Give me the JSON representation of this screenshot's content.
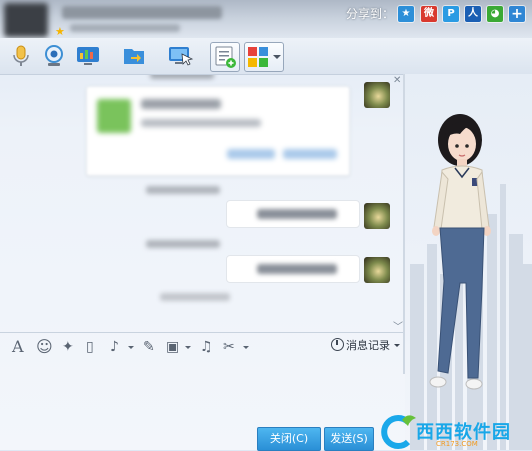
{
  "title_bar": {
    "share_label": "分享到：",
    "share_targets": [
      {
        "name": "qzone-share-icon",
        "glyph": "★"
      },
      {
        "name": "weibo-share-icon",
        "glyph": "微"
      },
      {
        "name": "pengyou-share-icon",
        "glyph": "P"
      },
      {
        "name": "renren-share-icon",
        "glyph": "人"
      },
      {
        "name": "wechat-share-icon",
        "glyph": "◕"
      },
      {
        "name": "more-share-icon",
        "glyph": "+"
      }
    ]
  },
  "toolbar": {
    "items": [
      "voice-call-icon",
      "video-call-icon",
      "screen-share-icon",
      "file-transfer-icon",
      "remote-assist-icon",
      "create-discussion-icon",
      "app-grid-icon"
    ]
  },
  "input_toolbar": {
    "font_glyph": "A",
    "emoji_glyph": "☺",
    "poke_glyph": "✦",
    "shake_glyph": "▯",
    "voice_glyph": "♪",
    "edit_glyph": "✎",
    "image_glyph": "▣",
    "music_glyph": "♫",
    "scissors_glyph": "✂",
    "history_label": "消息记录"
  },
  "buttons": {
    "close_label": "关闭(C)",
    "send_label": "发送(S)"
  },
  "watermark": {
    "brand_text": "西西软件园",
    "brand_sub": "CR173.COM"
  },
  "colors": {
    "accent": "#2a8fd6",
    "title_bar": "#c7d0dc",
    "background": "#edf2f9"
  }
}
